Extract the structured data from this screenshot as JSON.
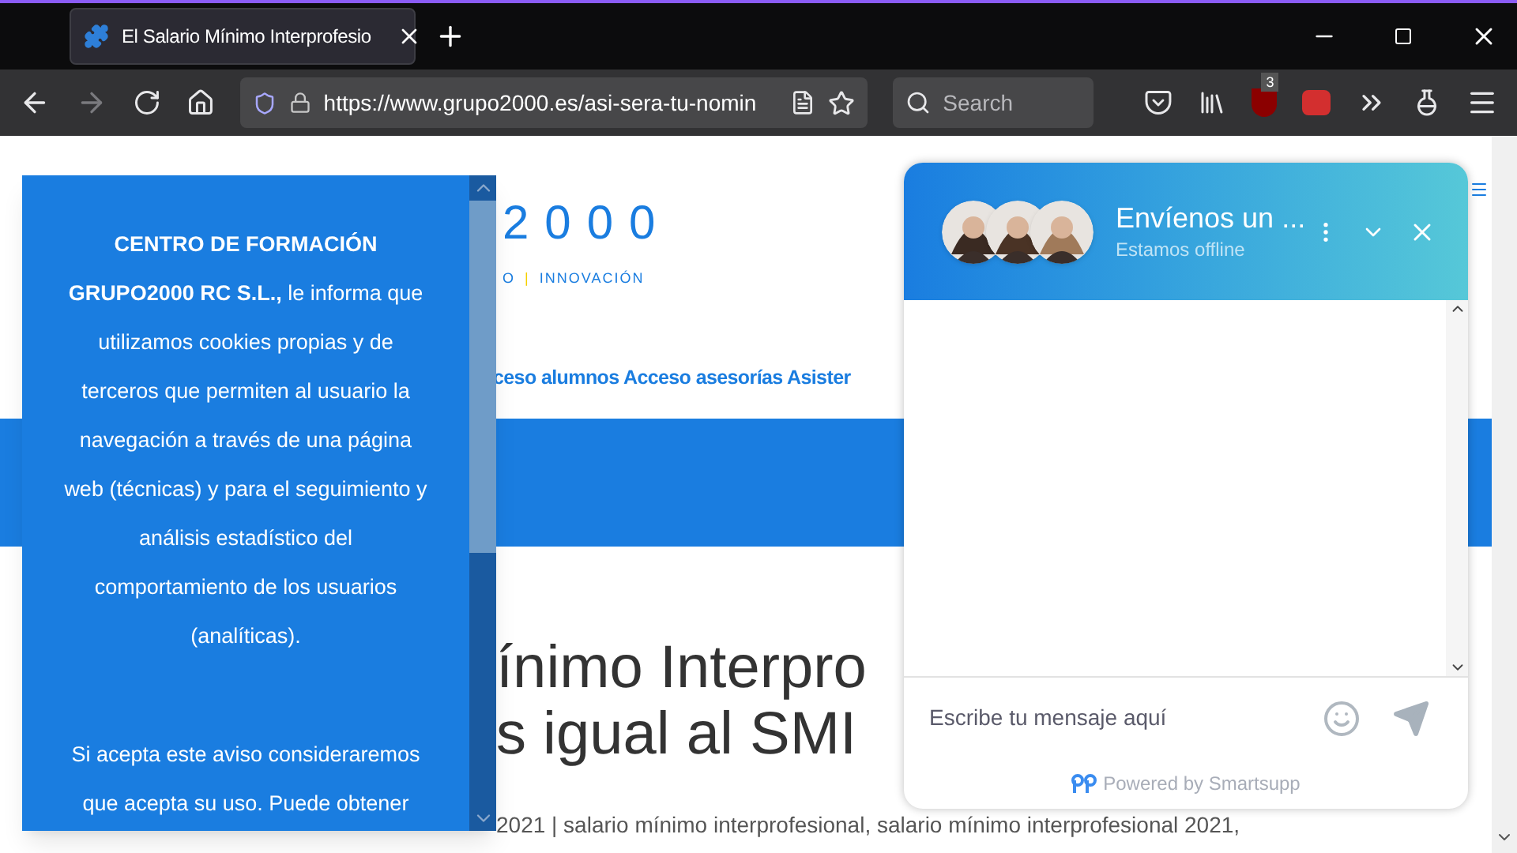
{
  "browser": {
    "tab": {
      "title": "El Salario Mínimo Interprofesio",
      "selected": true
    },
    "url": "https://www.grupo2000.es/asi-sera-tu-nomin",
    "search_placeholder": "Search",
    "addon_badge": "3"
  },
  "page": {
    "logo": "2000",
    "tagline": [
      {
        "text": "O",
        "kind": "word"
      },
      {
        "text": "|",
        "kind": "separator"
      },
      {
        "text": "INNOVACIÓN",
        "kind": "word"
      }
    ],
    "nav": "ceso alumnos Acceso asesorías Asister",
    "heading_lines": [
      "ínimo Interpro",
      "s igual al SMI"
    ],
    "meta": "2021 | salario mínimo interprofesional, salario mínimo interprofesional 2021,"
  },
  "cookie_notice": {
    "paragraphs": [
      "**CENTRO DE FORMACIÓN GRUPO2000 RC S.L.,** le informa que utilizamos cookies propias y de terceros que permiten al usuario la navegación a través de una página web (técnicas) y para el seguimiento y análisis estadístico del comportamiento de los usuarios (analíticas).",
      "Si acepta este aviso consideraremos que acepta su uso. Puede obtener"
    ]
  },
  "chat": {
    "title": "Envíenos un ...",
    "status": "Estamos offline",
    "placeholder": "Escribe tu mensaje aquí",
    "powered_by": "Powered by Smartsupp"
  }
}
